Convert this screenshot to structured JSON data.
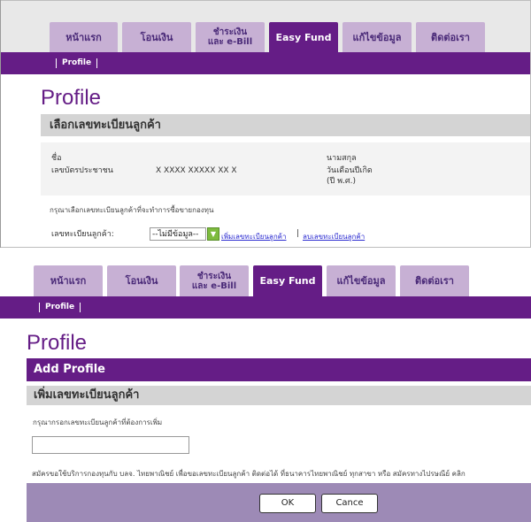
{
  "tabs": [
    {
      "label": "หน้าแรก",
      "line2": ""
    },
    {
      "label": "โอนเงิน",
      "line2": ""
    },
    {
      "label": "ชำระเงิน",
      "line2": "และ e-Bill"
    },
    {
      "label": "Easy Fund",
      "line2": ""
    },
    {
      "label": "แก้ไขข้อมูล",
      "line2": ""
    },
    {
      "label": "ติดต่อเรา",
      "line2": ""
    }
  ],
  "subnav": {
    "profile": "Profile"
  },
  "screen1": {
    "title": "Profile",
    "section": "เลือกเลขทะเบียนลูกค้า",
    "name_label": "ชื่อ",
    "id_label": "เลขบัตรประชาชน",
    "id_value": "X XXXX XXXXX XX X",
    "surname_label": "นามสกุล",
    "dob_label_1": "วันเดือนปีเกิด",
    "dob_label_2": "(ปี พ.ศ.)",
    "instruction": "กรุณาเลือกเลขทะเบียนลูกค้าที่จะทำการซื้อขายกองทุน",
    "reg_label": "เลขทะเบียนลูกค้า:",
    "select_value": "--ไม่มีข้อมูล--",
    "link_add": "เพิ่มเลขทะเบียนลูกค้า",
    "separator": "|",
    "link_delete": "ลบเลขทะเบียนลูกค้า"
  },
  "screen2": {
    "title": "Profile",
    "add_bar": "Add Profile",
    "section": "เพิ่มเลขทะเบียนลูกค้า",
    "instruction": "กรุณากรอกเลขทะเบียนลูกค้าที่ต้องการเพิ่ม",
    "input_value": "",
    "footnote": "สมัครขอใช้บริการกองทุนกับ บลจ. ไทยพาณิชย์ เพื่อขอเลขทะเบียนลูกค้า ติดต่อได้ ที่ธนาคารไทยพาณิชย์ ทุกสาขา หรือ สมัครทางไปรษณีย์ คลิก",
    "ok": "OK",
    "cancel": "Cance"
  }
}
